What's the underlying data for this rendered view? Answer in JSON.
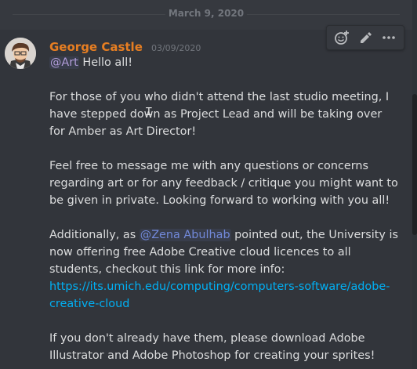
{
  "date_divider": "March 9, 2020",
  "message": {
    "author": "George Castle",
    "timestamp": "03/09/2020",
    "author_color": "#e67e22",
    "mention_art": "@Art",
    "greeting": " Hello all!",
    "para2": "For those of you who didn't attend the last studio meeting, I have stepped down as Project Lead and will be taking over for Amber as Art Director!",
    "para3": "Feel free to message me with any questions or concerns regarding art or for any feedback / critique you might want to be given in private. Looking forward to working with you all!",
    "para4_before": "Additionally, as ",
    "para4_mention": "@Zena Abulhab",
    "para4_after": " pointed out, the University is now offering free Adobe Creative cloud licences to all students, checkout this link for more info: ",
    "para4_link": "https://its.umich.edu/computing/computers-software/adobe-creative-cloud",
    "para5": "If you don't already have them, please download Adobe Illustrator and Adobe Photoshop for creating your sprites!"
  },
  "toolbar": {
    "icons": [
      "add-reaction-icon",
      "edit-icon",
      "more-icon"
    ]
  }
}
